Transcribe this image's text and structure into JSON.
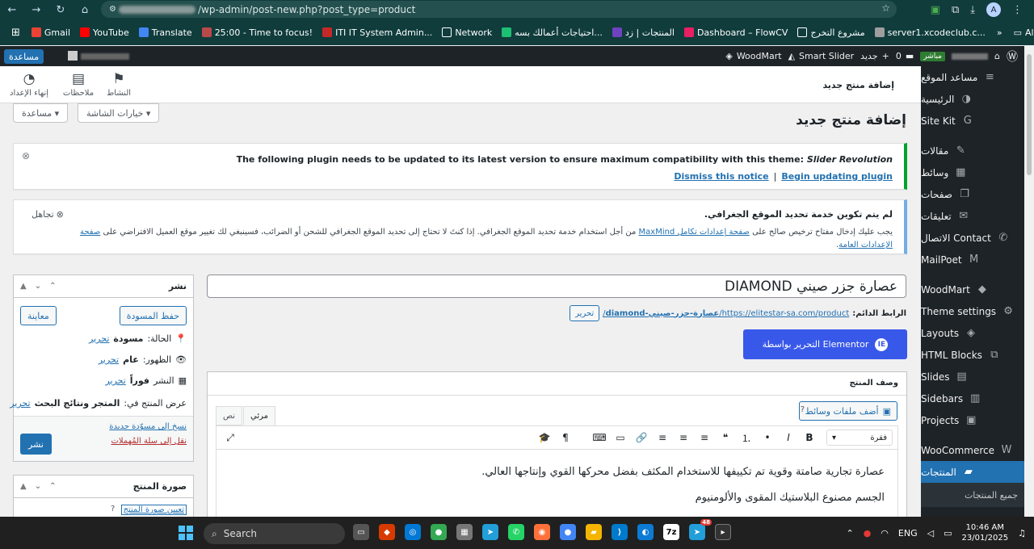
{
  "browser": {
    "url_suffix": "/wp-admin/post-new.php?post_type=product",
    "profile_initial": "A"
  },
  "bookmarks": [
    {
      "label": "Gmail",
      "color": "#ea4335"
    },
    {
      "label": "YouTube",
      "color": "#ff0000"
    },
    {
      "label": "Translate",
      "color": "#4285f4"
    },
    {
      "label": "25:00 - Time to focus!",
      "color": "#ba4949"
    },
    {
      "label": "ITI IT System Admin...",
      "color": "#c62828"
    },
    {
      "label": "Network",
      "color": ""
    },
    {
      "label": "احتياجات أعمالك بسه...",
      "color": "#1dbf73"
    },
    {
      "label": "المنتجات | زد",
      "color": "#6f42c1"
    },
    {
      "label": "Dashboard – FlowCV",
      "color": "#e91e63"
    },
    {
      "label": "مشروع التخرج",
      "color": ""
    },
    {
      "label": "server1.xcodeclub.c...",
      "color": "#9e9e9e"
    }
  ],
  "all_bookmarks": "All Bookmarks",
  "adminbar": {
    "help": "مساعدة",
    "live": "مباشر",
    "comments_count": "0",
    "new": "جديد",
    "smart_slider": "Smart Slider",
    "woodmart": "WoodMart"
  },
  "sidebar": {
    "items": [
      {
        "label": "مساعد الموقع",
        "icon": "≡"
      },
      {
        "label": "الرئيسية",
        "icon": "◑"
      },
      {
        "label": "Site Kit",
        "icon": "G"
      },
      {
        "label": "مقالات",
        "icon": "✎"
      },
      {
        "label": "وسائط",
        "icon": "▦"
      },
      {
        "label": "صفحات",
        "icon": "❐"
      },
      {
        "label": "تعليقات",
        "icon": "✉"
      },
      {
        "label": "Contact الاتصال",
        "icon": "✆"
      },
      {
        "label": "MailPoet",
        "icon": "M"
      },
      {
        "label": "WoodMart",
        "icon": "◆"
      },
      {
        "label": "Theme settings",
        "icon": "⚙"
      },
      {
        "label": "Layouts",
        "icon": "◈"
      },
      {
        "label": "HTML Blocks",
        "icon": "⧉"
      },
      {
        "label": "Slides",
        "icon": "▤"
      },
      {
        "label": "Sidebars",
        "icon": "▥"
      },
      {
        "label": "Projects",
        "icon": "▣"
      },
      {
        "label": "WooCommerce",
        "icon": "W"
      },
      {
        "label": "المنتجات",
        "icon": "▰"
      }
    ],
    "submenu_first": "جميع المنتجات"
  },
  "top_strip": {
    "title": "إضافة منتج جديد",
    "activity": "النشاط",
    "notes": "ملاحظات",
    "finish_setup": "إنهاء الإعداد"
  },
  "screen_options": "خيارات الشاشة ▾",
  "help_tab": "مساعدة ▾",
  "page_title": "إضافة منتج جديد",
  "plugin_notice": {
    "text": "The following plugin needs to be updated to its latest version to ensure maximum compatibility with this theme:",
    "plugin": "Slider Revolution",
    "begin": "Begin updating plugin",
    "separator": "|",
    "dismiss": "Dismiss this notice"
  },
  "geo_notice": {
    "title": "لم يتم تكوين خدمة تحديد الموقع الجغرافي.",
    "dismiss": "تجاهل",
    "text_a": "يجب عليك إدخال مفتاح ترخيص صالح على",
    "link_a": "صفحة إعدادات تكامل MaxMind",
    "text_b": "من أجل استخدام خدمة تحديد الموقع الجغرافي. إذا كنتَ لا تحتاج إلى تحديد الموقع الجغرافي للشحن أو الضرائب، فسينبغي لك تغيير موقع العميل الافتراضي على",
    "link_b": "صفحة الإعدادات العامة",
    "end": "."
  },
  "publish_box": {
    "title": "نشر",
    "save_draft": "حفظ المسودة",
    "preview": "معاينة",
    "status_label": "الحالة:",
    "status_value": "مسودة",
    "visibility_label": "الظهور:",
    "visibility_value": "عام",
    "publish_label": "النشر",
    "publish_value": "فوراً",
    "catalog_label": "عرض المنتج في:",
    "catalog_value": "المتجر ونتائج البحث",
    "edit": "تحرير",
    "copy_draft": "نسخ إلى مسوّدة جديدة",
    "trash": "نقل إلى سلة المُهملات",
    "publish_btn": "نشر"
  },
  "image_box": {
    "title": "صورة المنتج",
    "set_image": "تعيين صورة المنتج"
  },
  "product_title": "عصارة جزر صيني DIAMOND",
  "permalink": {
    "label": "الرابط الدائم:",
    "base": "https://elitestar-sa.com/product/",
    "slug": "عصارة-جزر-صيني-diamond",
    "suffix": "/",
    "edit": "تحرير"
  },
  "elementor_btn": "التحرير بواسطة Elementor",
  "description_box": {
    "title": "وصف المنتج",
    "add_media": "أضف ملفات وسائط",
    "tab_visual": "مرئي",
    "tab_text": "نص",
    "format_select": "فقرة",
    "paragraph1": "عصارة تجارية صامتة وقوية تم تكييفها للاستخدام المكثف بفضل محركها القوي وإنتاجها العالي.",
    "paragraph2": "الجسم مصنوع البلاستيك المقوى والألومنيوم"
  },
  "taskbar": {
    "search": "Search",
    "lang": "ENG",
    "time": "10:46 AM",
    "date": "23/01/2025",
    "telegram_badge": "48"
  }
}
